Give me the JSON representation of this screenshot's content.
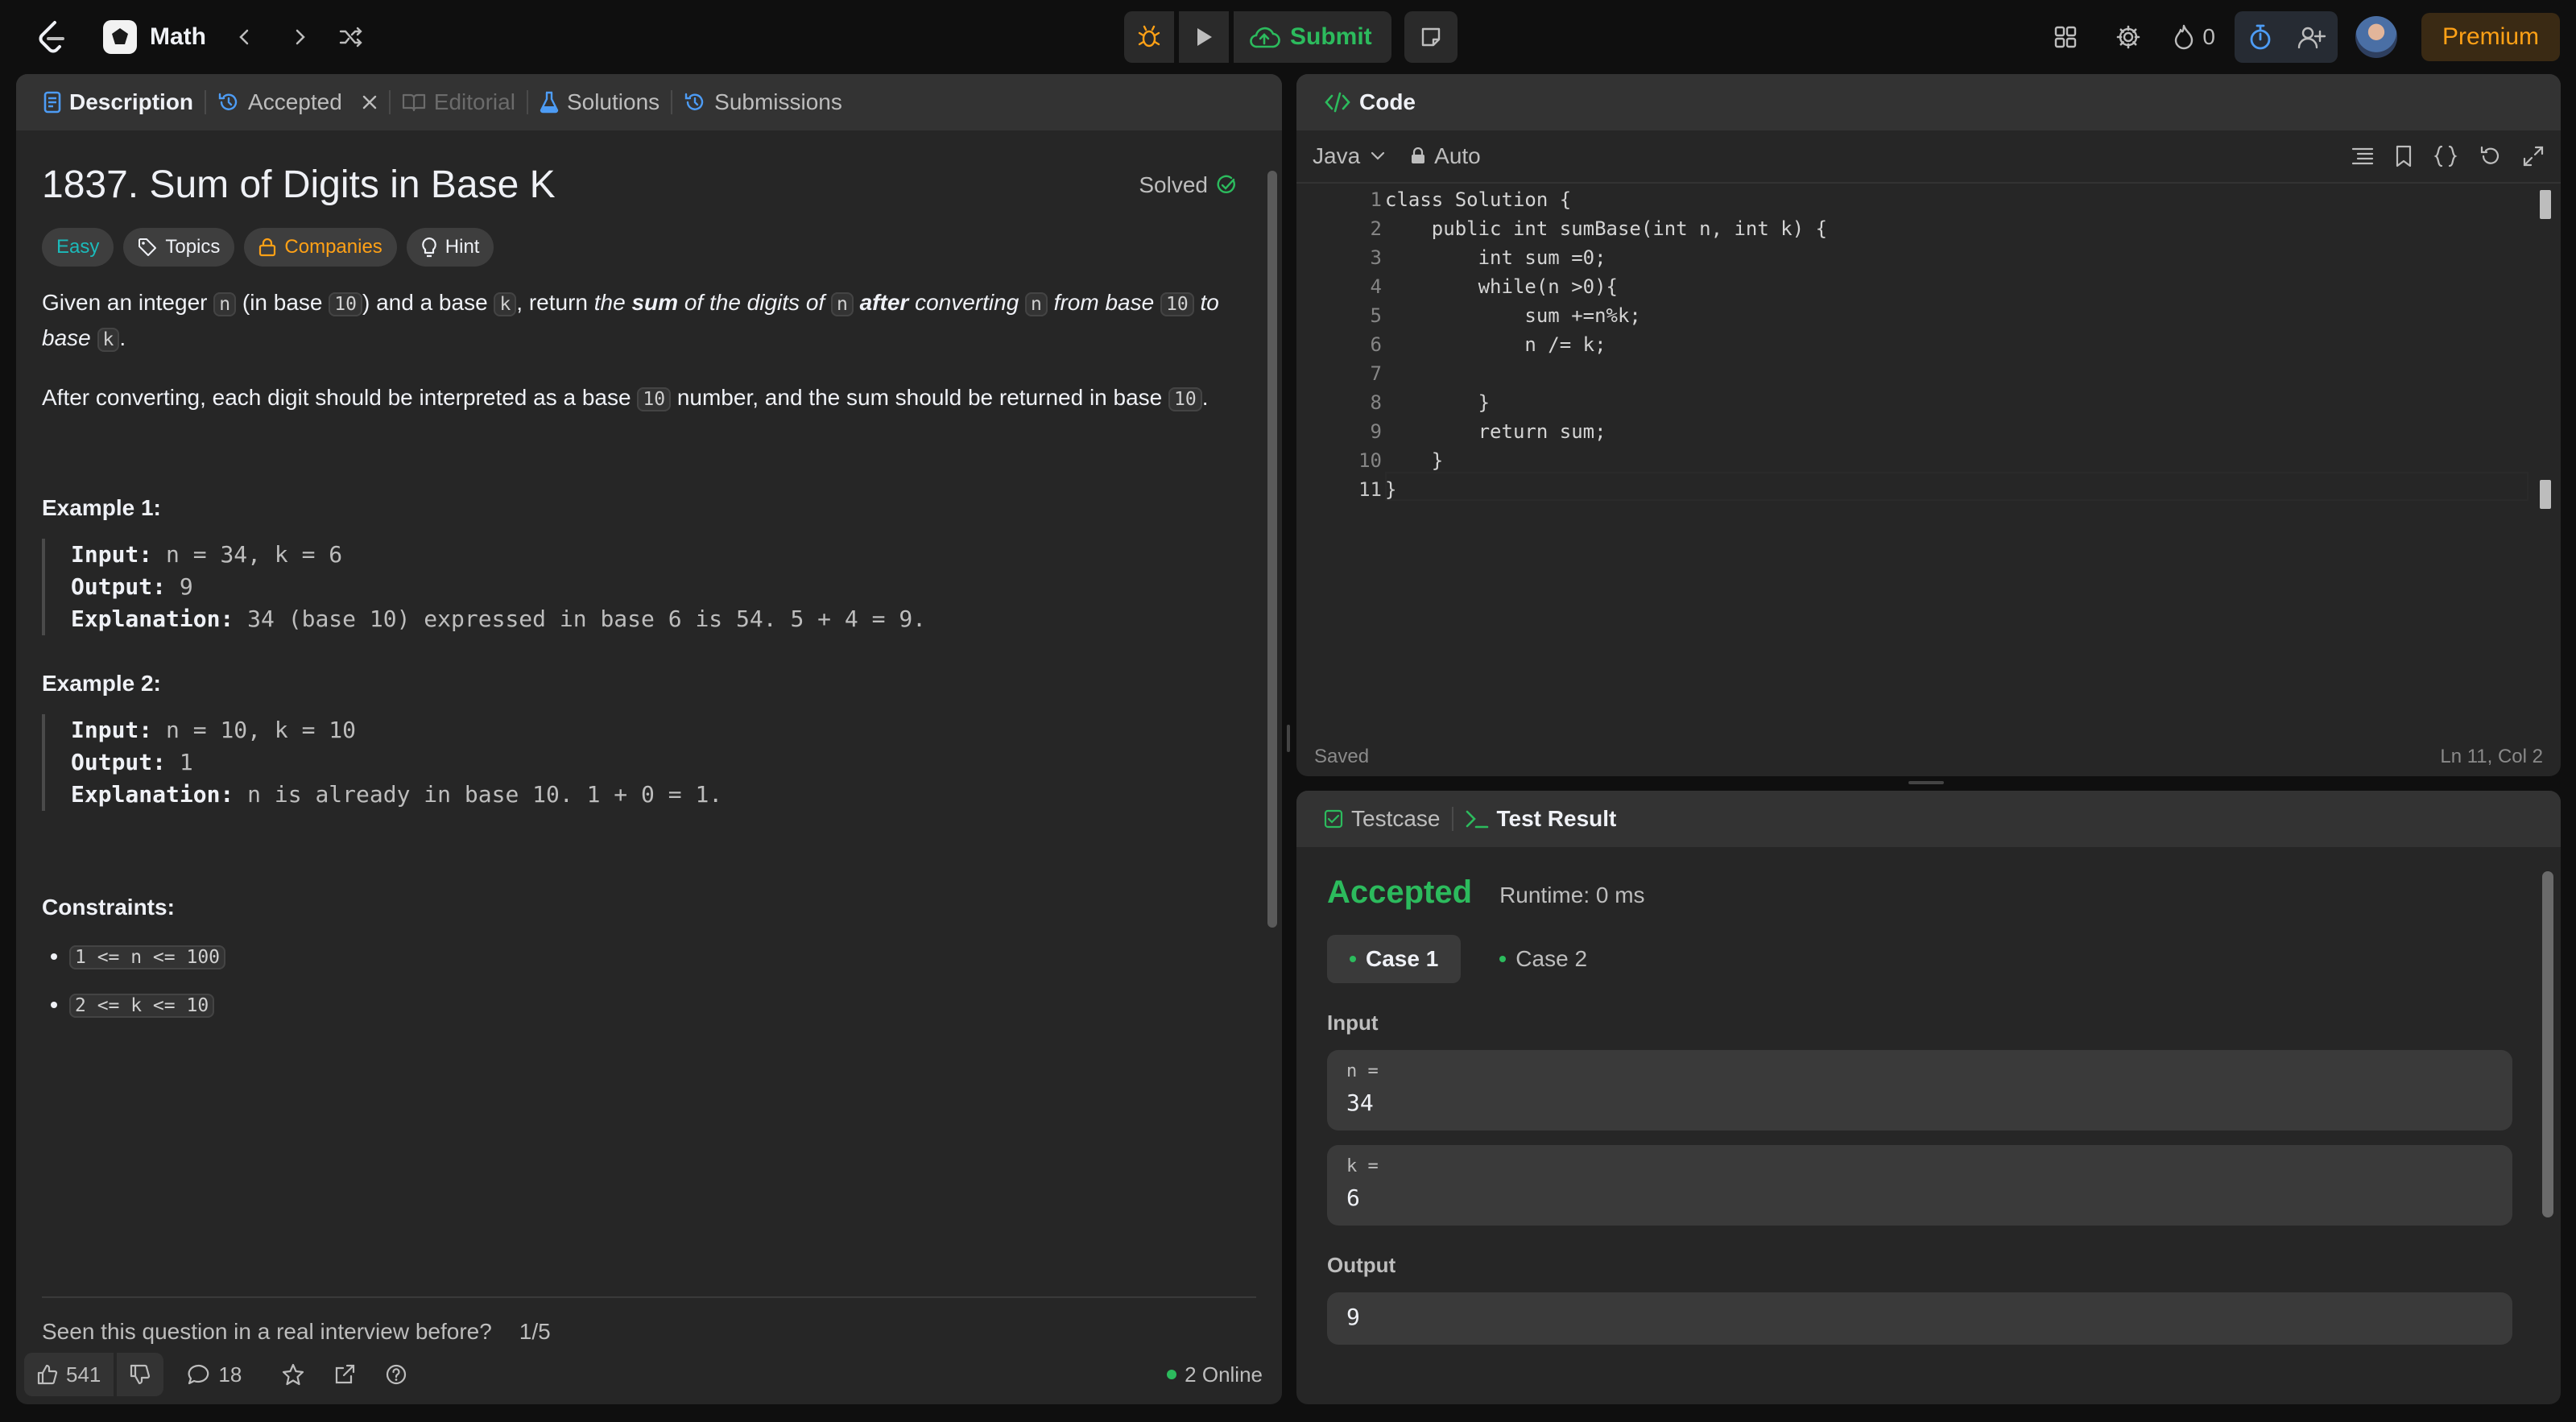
{
  "topbar": {
    "problem_list_label": "Math",
    "submit_label": "Submit",
    "streak_count": "0",
    "premium_label": "Premium"
  },
  "description": {
    "tabs": [
      "Description",
      "Accepted",
      "Editorial",
      "Solutions",
      "Submissions"
    ],
    "title": "1837. Sum of Digits in Base K",
    "solved_label": "Solved",
    "chips": {
      "difficulty": "Easy",
      "topics": "Topics",
      "companies": "Companies",
      "hint": "Hint"
    },
    "para1": {
      "a": "Given an integer ",
      "n1": "n",
      "b": " (in base ",
      "ten1": "10",
      "c": ") and a base ",
      "k1": "k",
      "d": ", return ",
      "e": "the ",
      "sum": "sum",
      "f": " of the digits of ",
      "n2": "n",
      "g": " ",
      "after": "after",
      "h": " converting ",
      "n3": "n",
      "i": " from base ",
      "ten2": "10",
      "j": " to base ",
      "k2": "k",
      "l": "."
    },
    "para2": {
      "a": "After converting, each digit should be interpreted as a base ",
      "ten1": "10",
      "b": " number, and the sum should be returned in base ",
      "ten2": "10",
      "c": "."
    },
    "example1": {
      "heading": "Example 1:",
      "input_lbl": "Input:",
      "input": "n = 34, k = 6",
      "output_lbl": "Output:",
      "output": "9",
      "expl_lbl": "Explanation:",
      "expl": "34 (base 10) expressed in base 6 is 54. 5 + 4 = 9."
    },
    "example2": {
      "heading": "Example 2:",
      "input_lbl": "Input:",
      "input": "n = 10, k = 10",
      "output_lbl": "Output:",
      "output": "1",
      "expl_lbl": "Explanation:",
      "expl": "n is already in base 10. 1 + 0 = 1."
    },
    "constraints_heading": "Constraints:",
    "constraints": [
      "1 <= n <= 100",
      "2 <= k <= 10"
    ],
    "feedback_question": "Seen this question in a real interview before?",
    "feedback_page": "1/5",
    "likes": "541",
    "comments": "18",
    "online": "2 Online"
  },
  "code": {
    "tab": "Code",
    "language": "Java",
    "mode": "Auto",
    "lines": [
      "class Solution {",
      "    public int sumBase(int n, int k) {",
      "        int sum =0;",
      "        while(n >0){",
      "            sum +=n%k;",
      "            n /= k;",
      "",
      "        }",
      "        return sum;",
      "    }",
      "}"
    ],
    "line_numbers": [
      "1",
      "2",
      "3",
      "4",
      "5",
      "6",
      "7",
      "8",
      "9",
      "10",
      "11"
    ],
    "status_left": "Saved",
    "status_right": "Ln 11, Col 2"
  },
  "result": {
    "tabs": [
      "Testcase",
      "Test Result"
    ],
    "verdict": "Accepted",
    "runtime": "Runtime: 0 ms",
    "cases": [
      "Case 1",
      "Case 2"
    ],
    "input_label": "Input",
    "inputs": [
      {
        "name": "n =",
        "value": "34"
      },
      {
        "name": "k =",
        "value": "6"
      }
    ],
    "output_label": "Output",
    "output_value": "9"
  },
  "colors": {
    "accent": "#ffa116",
    "success": "#2cbb5d",
    "easy": "#1cbaba",
    "timer": "#4d9cf5"
  }
}
